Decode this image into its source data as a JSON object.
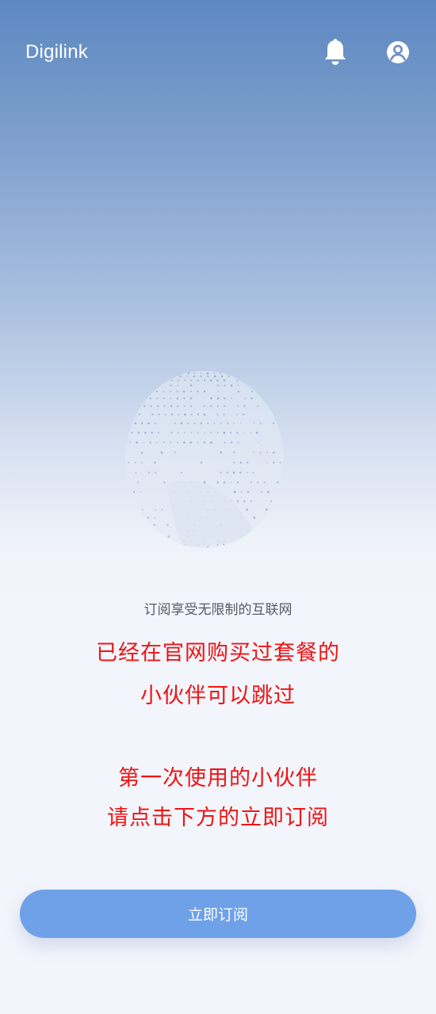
{
  "header": {
    "app_title": "Digilink",
    "bell_icon": "bell-icon",
    "account_icon": "account-circle-icon"
  },
  "hero": {
    "tagline": "订阅享受无限制的互联网",
    "globe_color": "#8aa5cc"
  },
  "notice": {
    "line1": "已经在官网购买过套餐的",
    "line2": "小伙伴可以跳过",
    "line3": "第一次使用的小伙伴",
    "line4": "请点击下方的立即订阅",
    "color": "#ee1414"
  },
  "actions": {
    "subscribe_label": "立即订阅",
    "button_color": "#6ea1e8"
  }
}
